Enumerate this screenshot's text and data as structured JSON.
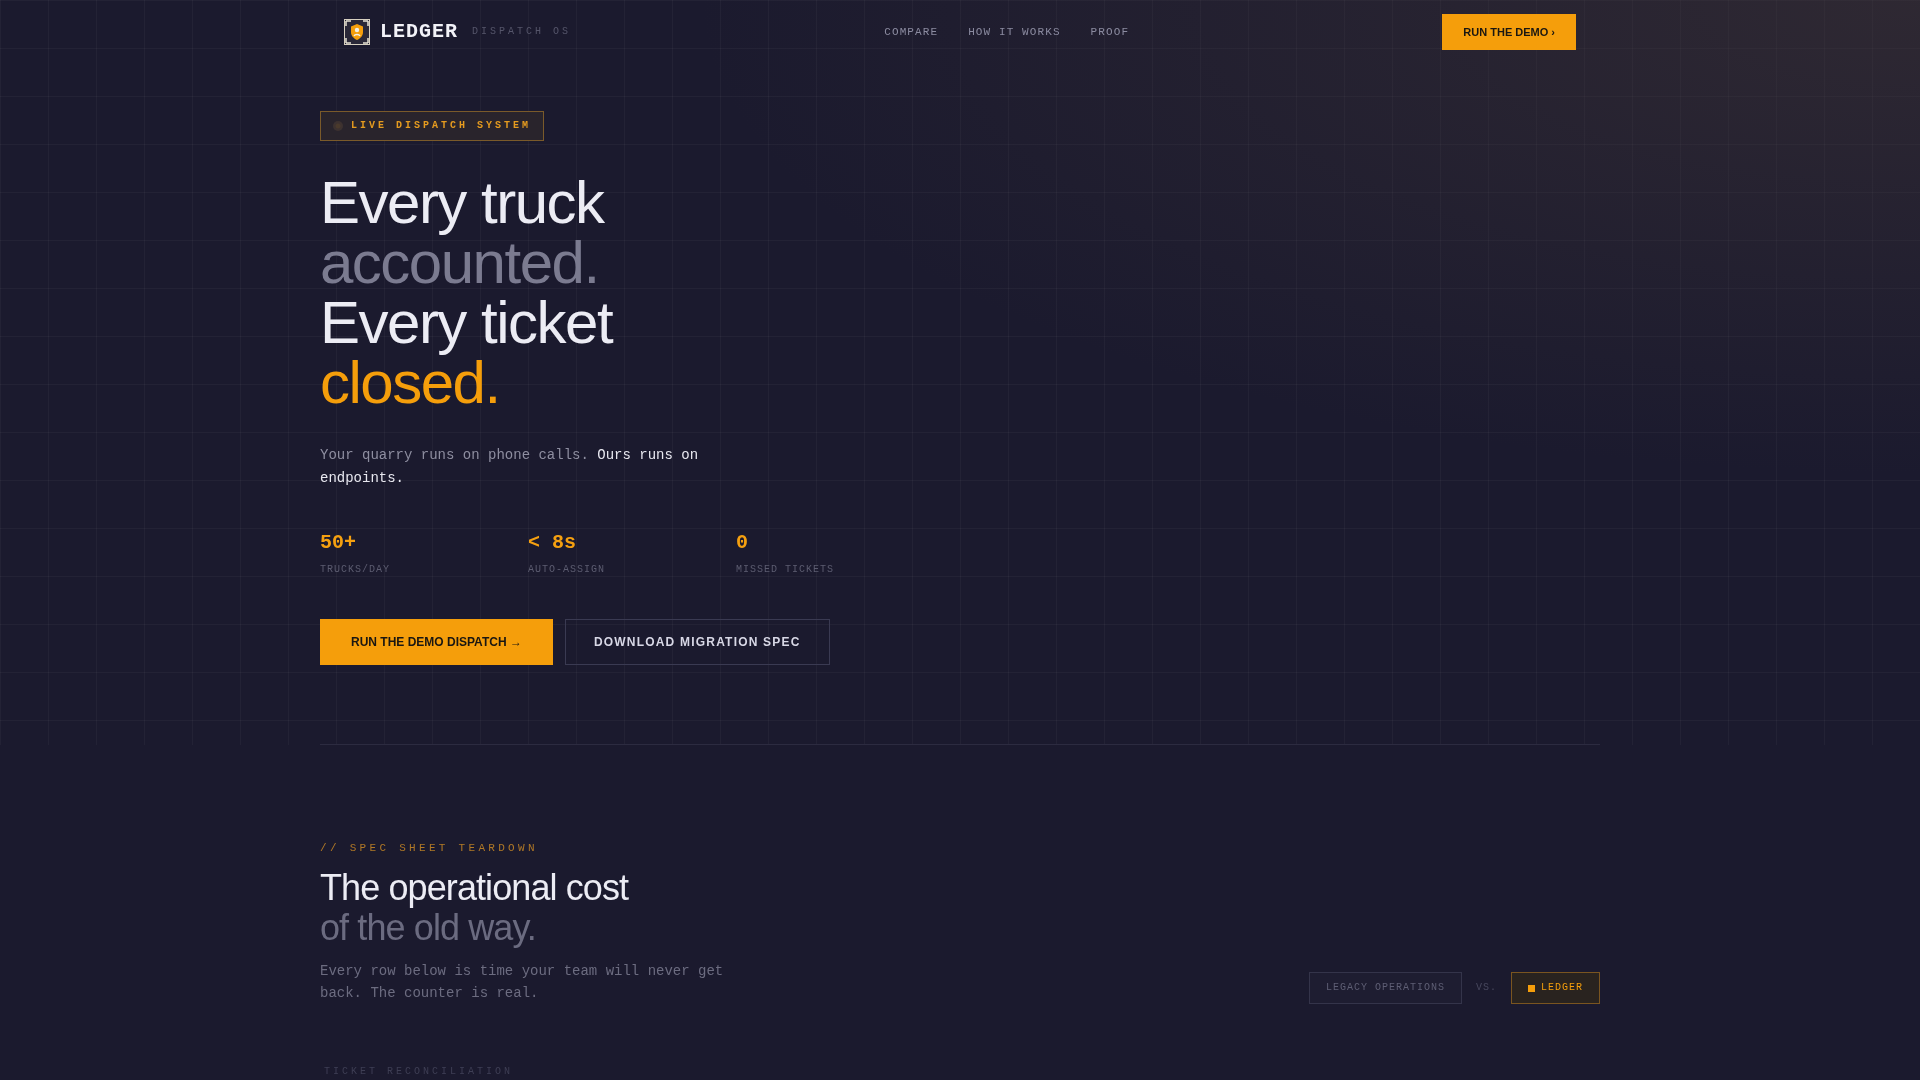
{
  "nav": {
    "logo": {
      "name": "LEDGER",
      "tagline": "DISPATCH OS"
    },
    "links": [
      {
        "label": "COMPARE"
      },
      {
        "label": "HOW IT WORKS"
      },
      {
        "label": "PROOF"
      }
    ],
    "cta": "RUN THE DEMO ›"
  },
  "hero": {
    "badge": "LIVE DISPATCH SYSTEM",
    "headline": [
      {
        "text": "Every truck",
        "kind": "primary"
      },
      {
        "text": "accounted.",
        "kind": "muted"
      },
      {
        "text": "Every ticket",
        "kind": "primary"
      },
      {
        "text": "closed.",
        "kind": "accent"
      }
    ],
    "description": {
      "text": "Your quarry runs on phone calls.",
      "emphasis": "Ours runs on endpoints."
    },
    "stats": [
      {
        "value": "50+",
        "label": "TRUCKS/DAY"
      },
      {
        "value": "< 8s",
        "label": "AUTO-ASSIGN"
      },
      {
        "value": "0",
        "label": "MISSED TICKETS"
      }
    ],
    "buttons": [
      {
        "label": "RUN THE DEMO DISPATCH →",
        "kind": "primary"
      },
      {
        "label": "DOWNLOAD MIGRATION SPEC",
        "kind": "secondary"
      }
    ]
  },
  "comparison": {
    "eyebrow": "// SPEC SHEET TEARDOWN",
    "title": [
      {
        "text": "The operational cost",
        "kind": "primary"
      },
      {
        "text": "of the old way.",
        "kind": "muted"
      }
    ],
    "description": "Every row below is time your team will never get back. The counter is real.",
    "toggle": {
      "options": [
        {
          "label": "LEGACY OPERATIONS",
          "selected": false
        },
        {
          "label": "LEDGER",
          "selected": true
        }
      ],
      "separator": "VS."
    },
    "table_label": "TICKET RECONCILIATION"
  }
}
